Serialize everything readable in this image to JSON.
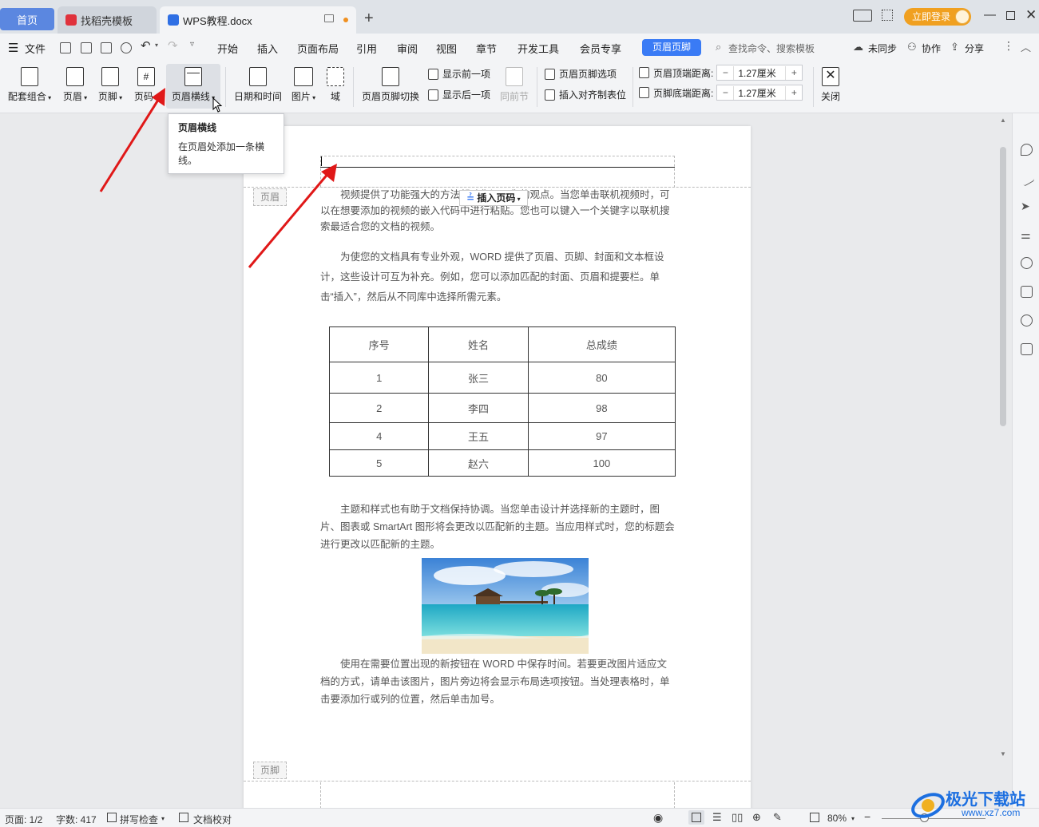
{
  "tabs": {
    "home": "首页",
    "store": "找稻壳模板",
    "doc": "WPS教程.docx"
  },
  "titlebar": {
    "login": "立即登录"
  },
  "menu": {
    "file": "文件",
    "items": [
      "开始",
      "插入",
      "页面布局",
      "引用",
      "审阅",
      "视图",
      "章节",
      "开发工具",
      "会员专享"
    ],
    "active": "页眉页脚",
    "search": "查找命令、搜索模板",
    "sync": "未同步",
    "collab": "协作",
    "share": "分享"
  },
  "ribbon": {
    "combo": "配套组合",
    "header": "页眉",
    "footer": "页脚",
    "pagenum": "页码",
    "headerline": "页眉横线",
    "datetime": "日期和时间",
    "picture": "图片",
    "field": "域",
    "switch": "页眉页脚切换",
    "show_prev": "显示前一项",
    "show_next": "显示后一项",
    "same_section": "同前节",
    "hf_options": "页眉页脚选项",
    "align_tab": "插入对齐制表位",
    "header_top": "页眉顶端距离:",
    "footer_bottom": "页脚底端距离:",
    "header_top_val": "1.27厘米",
    "footer_bottom_val": "1.27厘米",
    "close": "关闭"
  },
  "tooltip": {
    "title": "页眉横线",
    "body": "在页眉处添加一条横线。"
  },
  "doc": {
    "header_label": "页眉",
    "footer_label": "页脚",
    "insert_pagenum": "插入页码",
    "p1": "视频提供了功能强大的方法帮助您证明您的观点。当您单击联机视频时，可以在想要添加的视频的嵌入代码中进行粘贴。您也可以键入一个关键字以联机搜索最适合您的文档的视频。",
    "p2": "为使您的文档具有专业外观，WORD 提供了页眉、页脚、封面和文本框设计，这些设计可互为补充。例如，您可以添加匹配的封面、页眉和提要栏。单击“插入”，然后从不同库中选择所需元素。",
    "table": {
      "headers": [
        "序号",
        "姓名",
        "总成绩"
      ],
      "rows": [
        [
          "1",
          "张三",
          "80"
        ],
        [
          "2",
          "李四",
          "98"
        ],
        [
          "4",
          "王五",
          "97"
        ],
        [
          "5",
          "赵六",
          "100"
        ]
      ]
    },
    "p3": "主题和样式也有助于文档保持协调。当您单击设计并选择新的主题时，图片、图表或 SmartArt 图形将会更改以匹配新的主题。当应用样式时，您的标题会进行更改以匹配新的主题。",
    "p4": "使用在需要位置出现的新按钮在 WORD 中保存时间。若要更改图片适应文档的方式，请单击该图片，图片旁边将会显示布局选项按钮。当处理表格时，单击要添加行或列的位置，然后单击加号。"
  },
  "status": {
    "page": "页面: 1/2",
    "words": "字数: 417",
    "spell": "拼写检查",
    "proof": "文档校对",
    "zoom": "80%"
  },
  "watermark": {
    "name": "极光下载站",
    "url": "www.xz7.com"
  }
}
